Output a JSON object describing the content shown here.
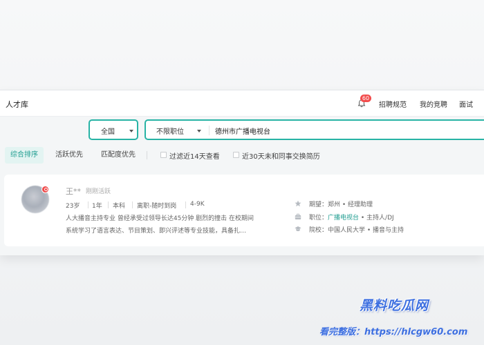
{
  "header": {
    "app_title": "人才库",
    "notification_count": "60",
    "nav": [
      "招聘规范",
      "我的竞聘",
      "面试"
    ]
  },
  "search": {
    "region": "全国",
    "position_filter": "不限职位",
    "keyword": "德州市广播电视台"
  },
  "sort": {
    "tabs": [
      "综合排序",
      "活跃优先",
      "匹配度优先"
    ],
    "active_tab": 0,
    "filters": [
      {
        "label": "过滤近14天查看",
        "checked": false
      },
      {
        "label": "近30天未和同事交换简历",
        "checked": false
      }
    ]
  },
  "candidate": {
    "name": "王**",
    "activity": "刚刚活跃",
    "meta": [
      "23岁",
      "1年",
      "本科",
      "离职-随时到岗",
      "4-9K"
    ],
    "description_line1": "人大播音主持专业 曾经承受过领导长达45分钟 剧烈的撞击 在校期间",
    "description_line2": "系统学习了语言表达、节目策划、即兴评述等专业技能，具备扎…",
    "expect_label": "期望：",
    "expect_value": "郑州 • 经理助理",
    "job_label": "职位：",
    "job_company": "广播电视台",
    "job_role": " • 主持人/DJ",
    "school_label": "院校：",
    "school_value": "中国人民大学 • 播音与主持"
  },
  "watermark": {
    "brand": "黑料吃瓜网",
    "sub": "看完整版：https://hlcgw60.com"
  },
  "colors": {
    "accent": "#27b3a5",
    "accent_text": "#1f9d90",
    "badge": "#f24c4c",
    "watermark": "#3d6fe0"
  }
}
